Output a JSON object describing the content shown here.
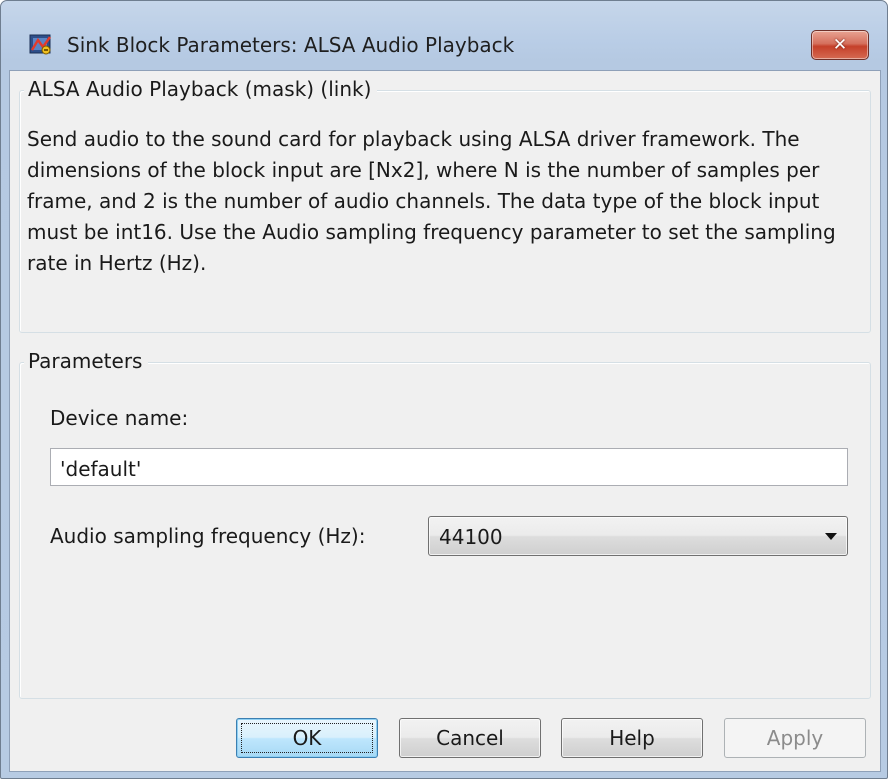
{
  "window": {
    "title": "Sink Block Parameters: ALSA Audio Playback",
    "close_glyph": "✕"
  },
  "mask_group": {
    "title": "ALSA Audio Playback (mask) (link)",
    "description": "Send audio to the sound card for playback using ALSA driver framework. The dimensions of the block input are [Nx2], where N is the number of samples per frame, and 2 is the number of audio channels. The data type of the block input must be int16. Use the Audio sampling frequency parameter to set the sampling rate in Hertz (Hz)."
  },
  "parameters_group": {
    "title": "Parameters",
    "device_name_label": "Device name:",
    "device_name_value": "'default'",
    "sampling_label": "Audio sampling frequency (Hz):",
    "sampling_value": "44100"
  },
  "buttons": {
    "ok": "OK",
    "cancel": "Cancel",
    "help": "Help",
    "apply": "Apply"
  },
  "colors": {
    "title_bar": "#b9cde6",
    "dialog_background": "#f0f0f0",
    "close_button": "#c5402a",
    "default_button": "#bee6fd"
  },
  "icons": {
    "app": "simulink-block-icon",
    "close": "close-icon",
    "dropdown": "chevron-down-icon"
  }
}
